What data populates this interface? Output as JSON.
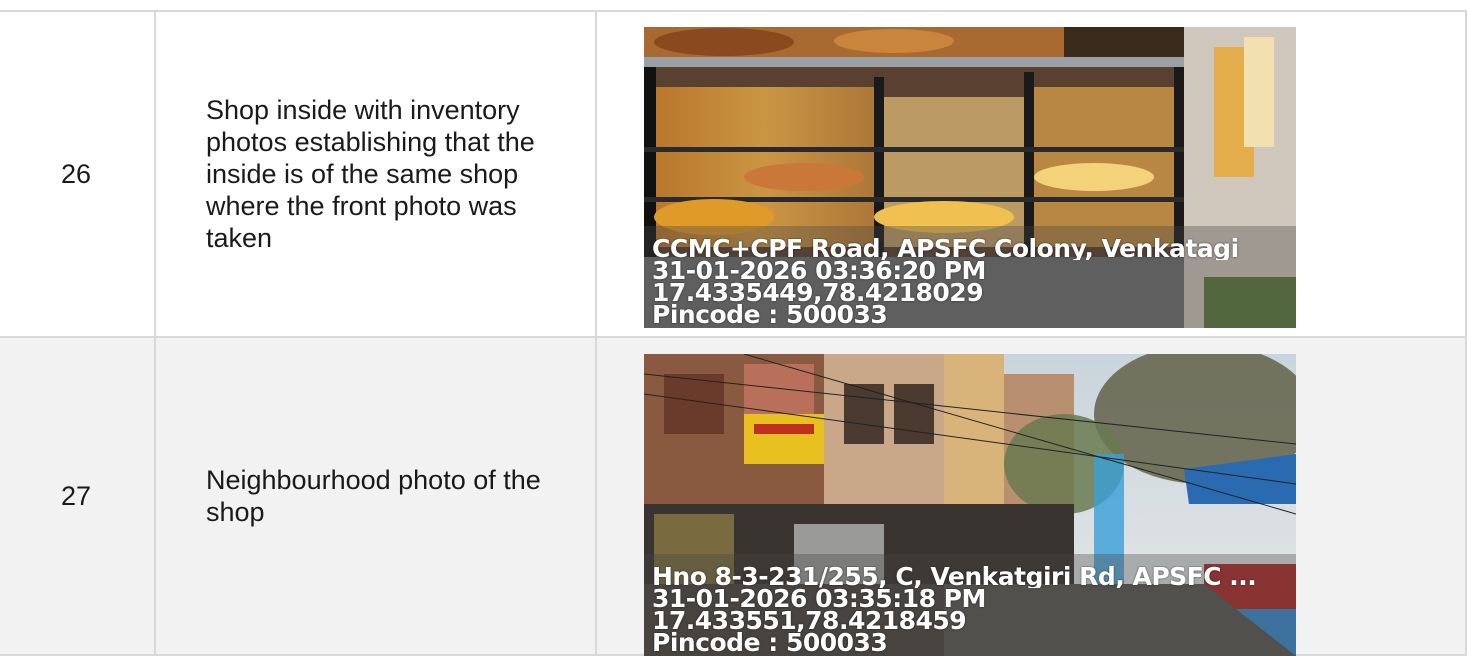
{
  "rows": [
    {
      "number": "26",
      "description": "Shop inside with inventory photos establishing that the inside is of the same shop where the front photo was taken",
      "photo_stamp": {
        "address": "CCMC+CPF Road, APSFC Colony, Venkatagi",
        "datetime": "31-01-2026 03:36:20 PM",
        "coordinates": "17.4335449,78.4218029",
        "pincode": "Pincode : 500033"
      }
    },
    {
      "number": "27",
      "description": "Neighbourhood photo of the shop",
      "photo_stamp": {
        "address": "Hno 8-3-231/255, C, Venkatgiri Rd, APSFC ...",
        "datetime": "31-01-2026 03:35:18 PM",
        "coordinates": "17.433551,78.4218459",
        "pincode": "Pincode : 500033"
      }
    }
  ],
  "colors": {
    "border": "#d9d9d9",
    "alt_row": "#f2f2f2",
    "text": "#1a1a1a"
  }
}
